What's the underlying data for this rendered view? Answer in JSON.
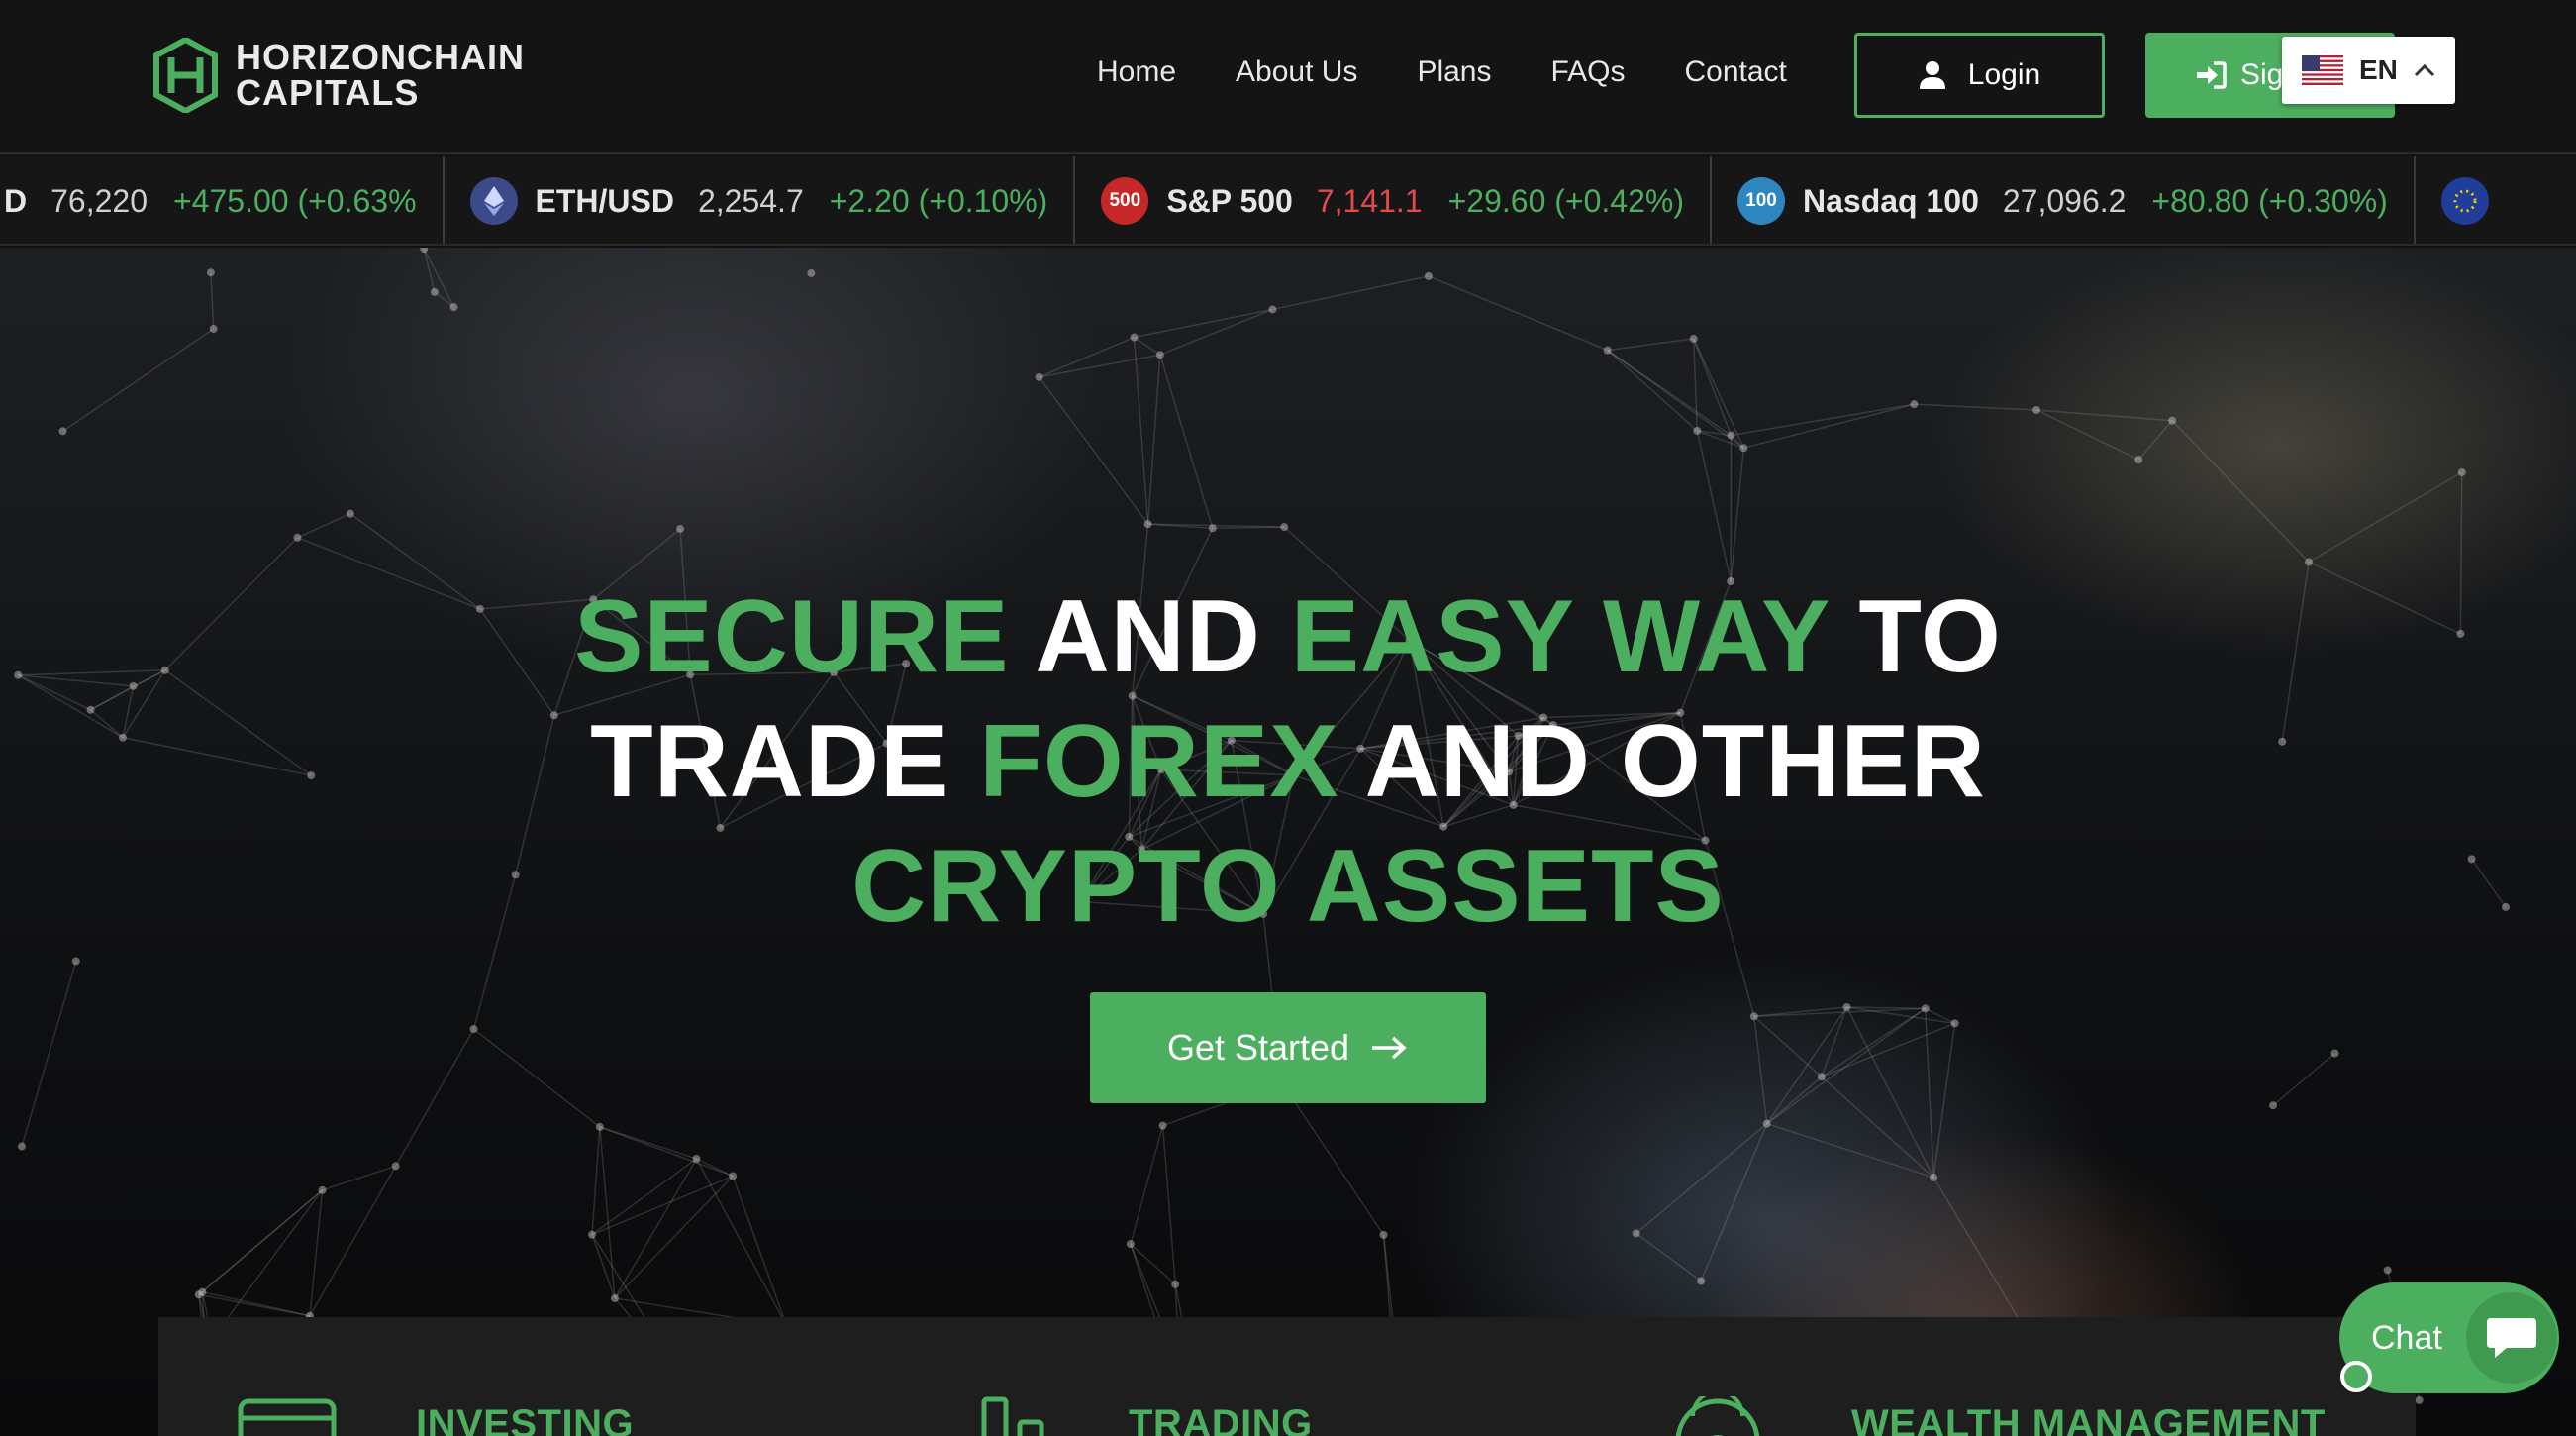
{
  "brand": {
    "line1": "HORIZONCHAIN",
    "line2": "CAPITALS",
    "accent": "#4caf5f"
  },
  "nav": {
    "items": [
      "Home",
      "About Us",
      "Plans",
      "FAQs",
      "Contact"
    ]
  },
  "header_buttons": {
    "login": "Login",
    "signup": "Sig"
  },
  "language": {
    "code": "EN",
    "flag": "us-flag-icon"
  },
  "ticker": [
    {
      "symbol": "D",
      "price": "76,220",
      "change": "+475.00 (+0.63%",
      "icon": ""
    },
    {
      "symbol": "ETH/USD",
      "price": "2,254.7",
      "change": "+2.20 (+0.10%)",
      "icon": "ethereum-icon"
    },
    {
      "symbol": "S&P 500",
      "price": "7,141.1",
      "change": "+29.60 (+0.42%)",
      "icon": "500"
    },
    {
      "symbol": "Nasdaq 100",
      "price": "27,096.2",
      "change": "+80.80 (+0.30%)",
      "icon": "100"
    }
  ],
  "hero": {
    "line1": {
      "a": "SECURE",
      "b": "AND",
      "c": "EASY WAY",
      "d": "TO"
    },
    "line2": {
      "a": "TRADE",
      "b": "FOREX",
      "c": "AND OTHER"
    },
    "line3": {
      "a": "CRYPTO ASSETS"
    },
    "cta": "Get Started"
  },
  "services": [
    "INVESTING",
    "TRADING",
    "WEALTH MANAGEMENT"
  ],
  "chat": {
    "label": "Chat"
  }
}
